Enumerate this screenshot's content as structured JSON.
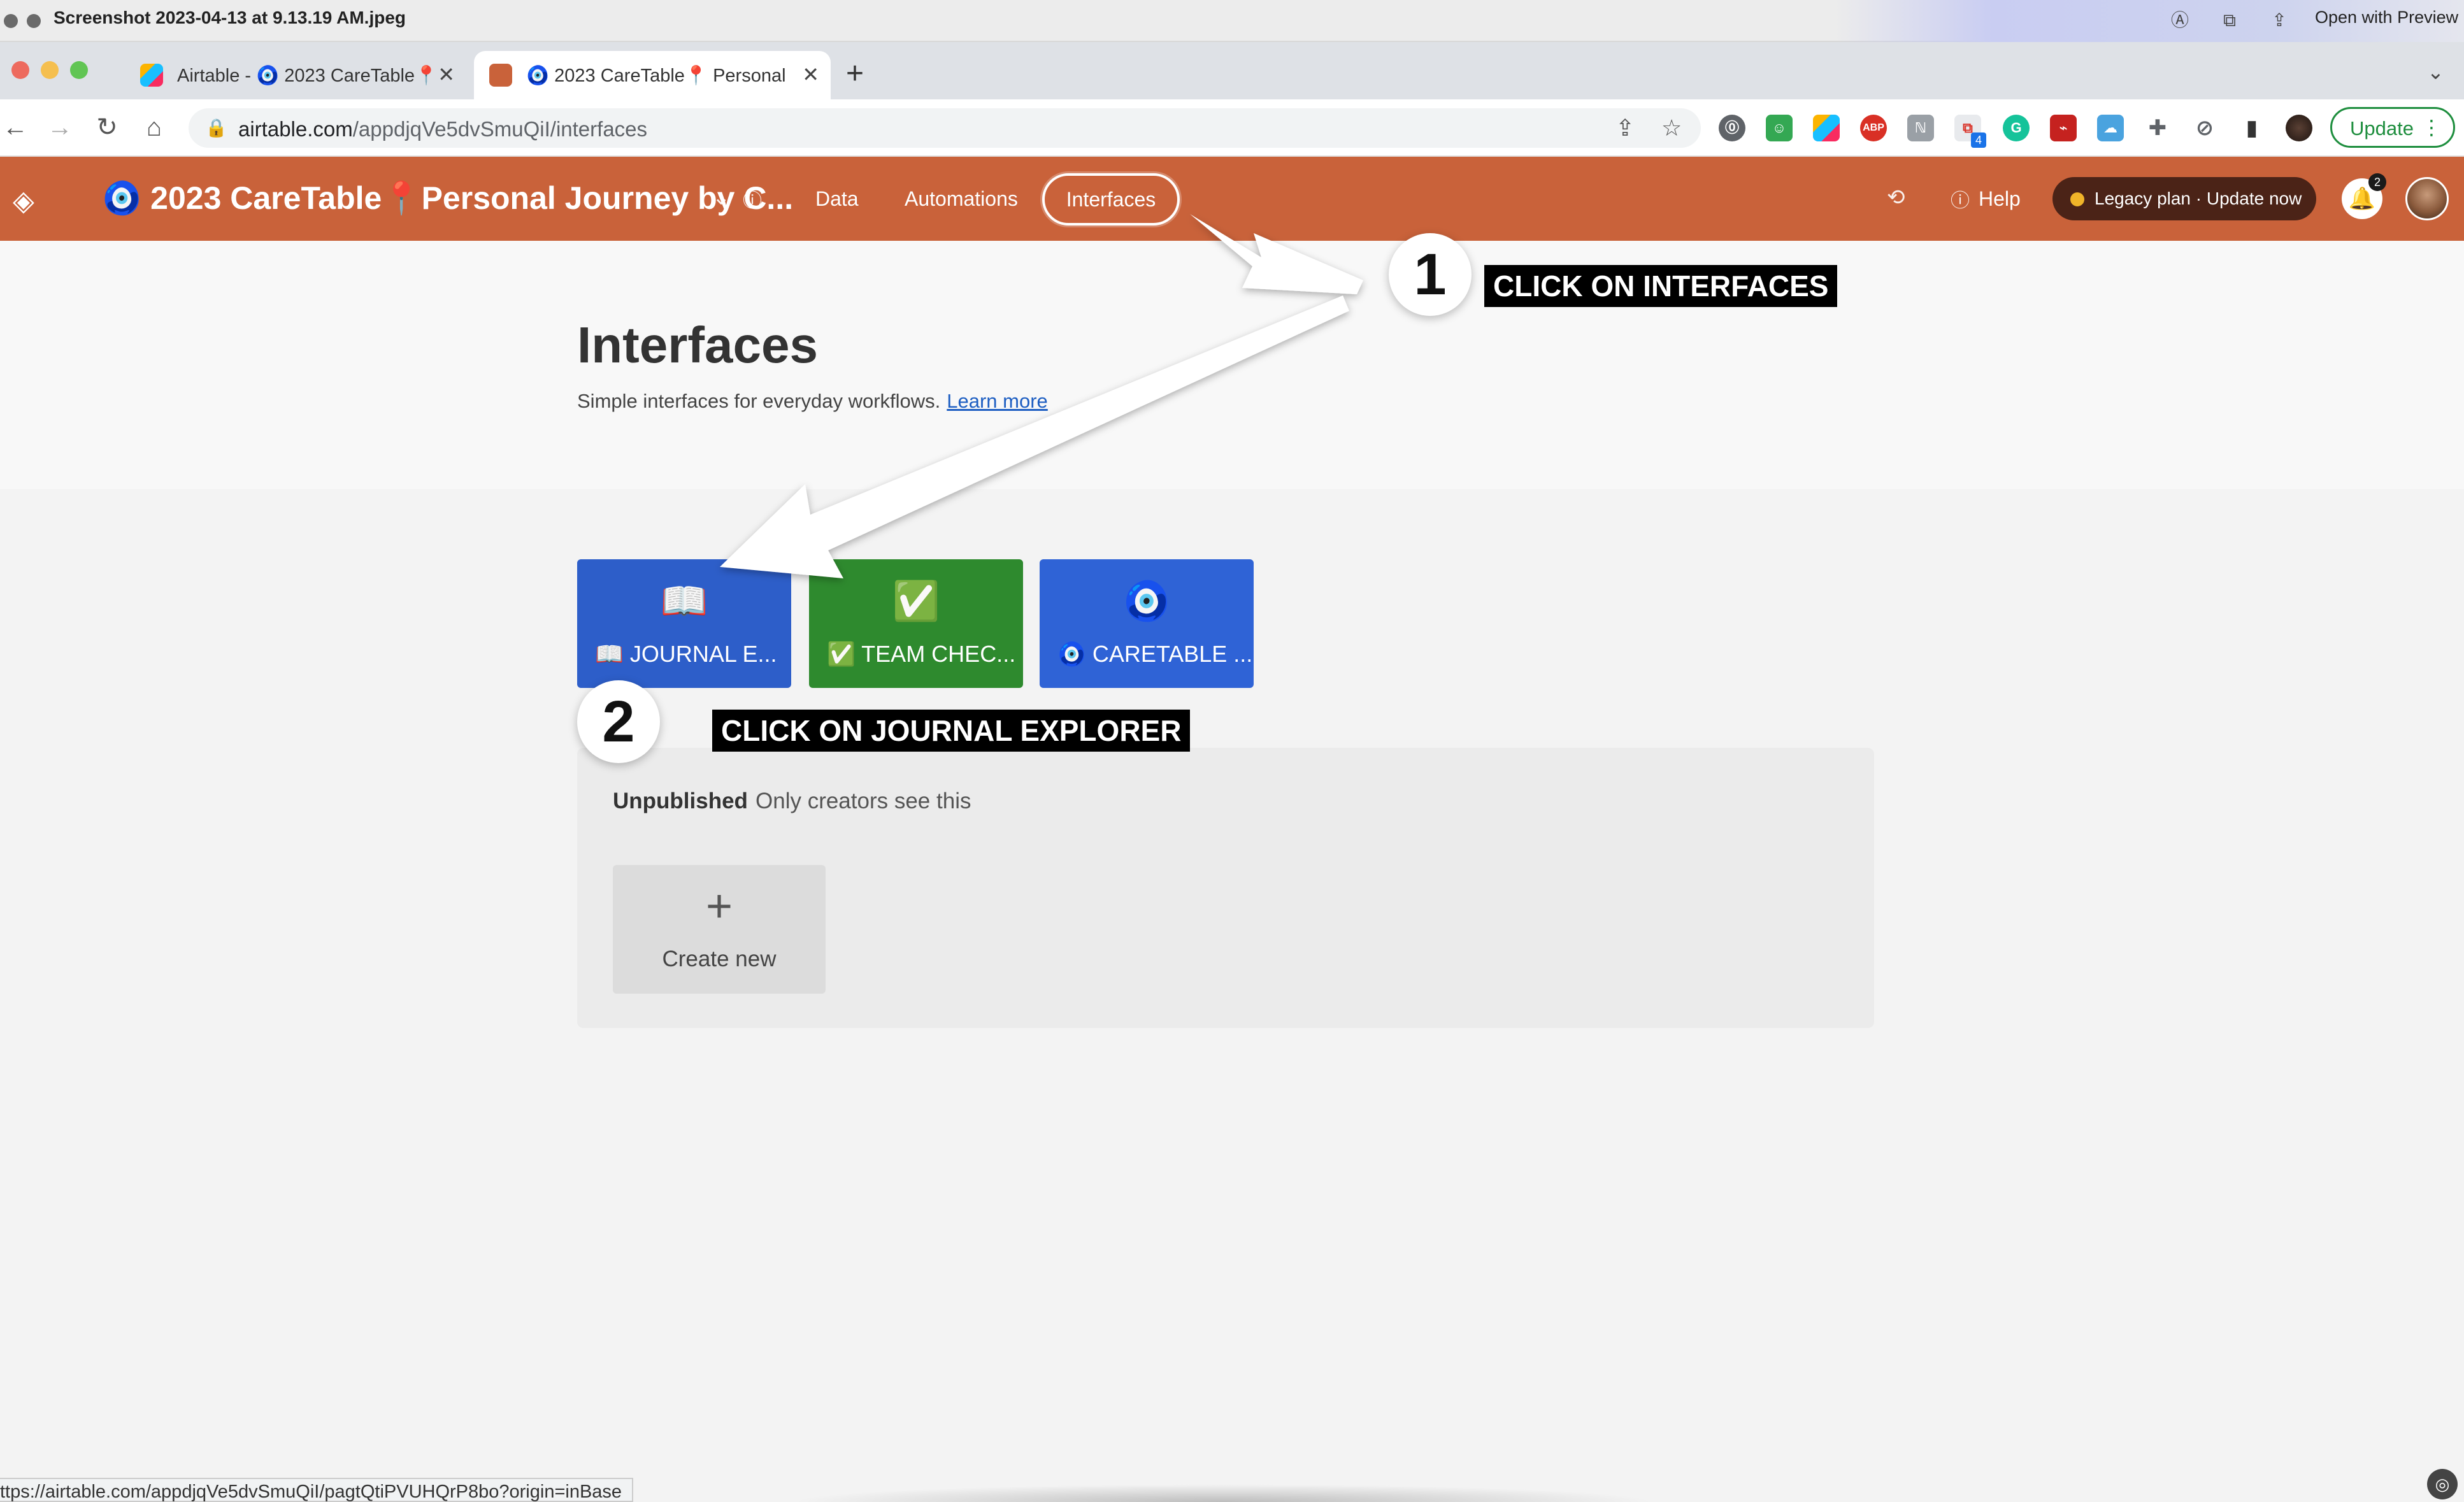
{
  "preview": {
    "title": "Screenshot 2023-04-13 at 9.13.19 AM.jpeg",
    "open_with": "Open with Preview"
  },
  "browser": {
    "tabs": [
      {
        "title": "Airtable - 🧿 2023 CareTable📍",
        "active": false
      },
      {
        "title": "🧿 2023 CareTable📍 Personal",
        "active": true
      }
    ],
    "url_host": "airtable.com",
    "url_path": "/appdjqVe5dvSmuQiI/interfaces",
    "update_label": "Update",
    "extension_badge": "4"
  },
  "header": {
    "base_name": "🧿 2023 CareTable📍Personal Journey by C...",
    "nav": [
      "Data",
      "Automations",
      "Interfaces"
    ],
    "active_nav": "Interfaces",
    "help_label": "Help",
    "plan_label": "Legacy plan · Update now",
    "notification_count": "2",
    "accent_color": "#c9623a"
  },
  "page": {
    "title": "Interfaces",
    "subtitle": "Simple interfaces for everyday workflows.",
    "learn_more": "Learn more"
  },
  "interfaces": [
    {
      "icon": "📖",
      "label": "📖 JOURNAL E...",
      "color": "#2d5ec9"
    },
    {
      "icon": "✅",
      "label": "✅ TEAM CHEC...",
      "color": "#2e8a2e"
    },
    {
      "icon": "🧿",
      "label": "🧿 CARETABLE ...",
      "color": "#2f63d6"
    }
  ],
  "unpublished": {
    "title": "Unpublished",
    "note": "Only creators see this",
    "create_new": "Create new",
    "plus": "+"
  },
  "annotations": {
    "step1_number": "1",
    "step1_text": "CLICK ON INTERFACES",
    "step2_number": "2",
    "step2_text": "CLICK ON JOURNAL EXPLORER"
  },
  "status_bar": {
    "url": "ttps://airtable.com/appdjqVe5dvSmuQiI/pagtQtiPVUHQrP8bo?origin=inBase"
  }
}
